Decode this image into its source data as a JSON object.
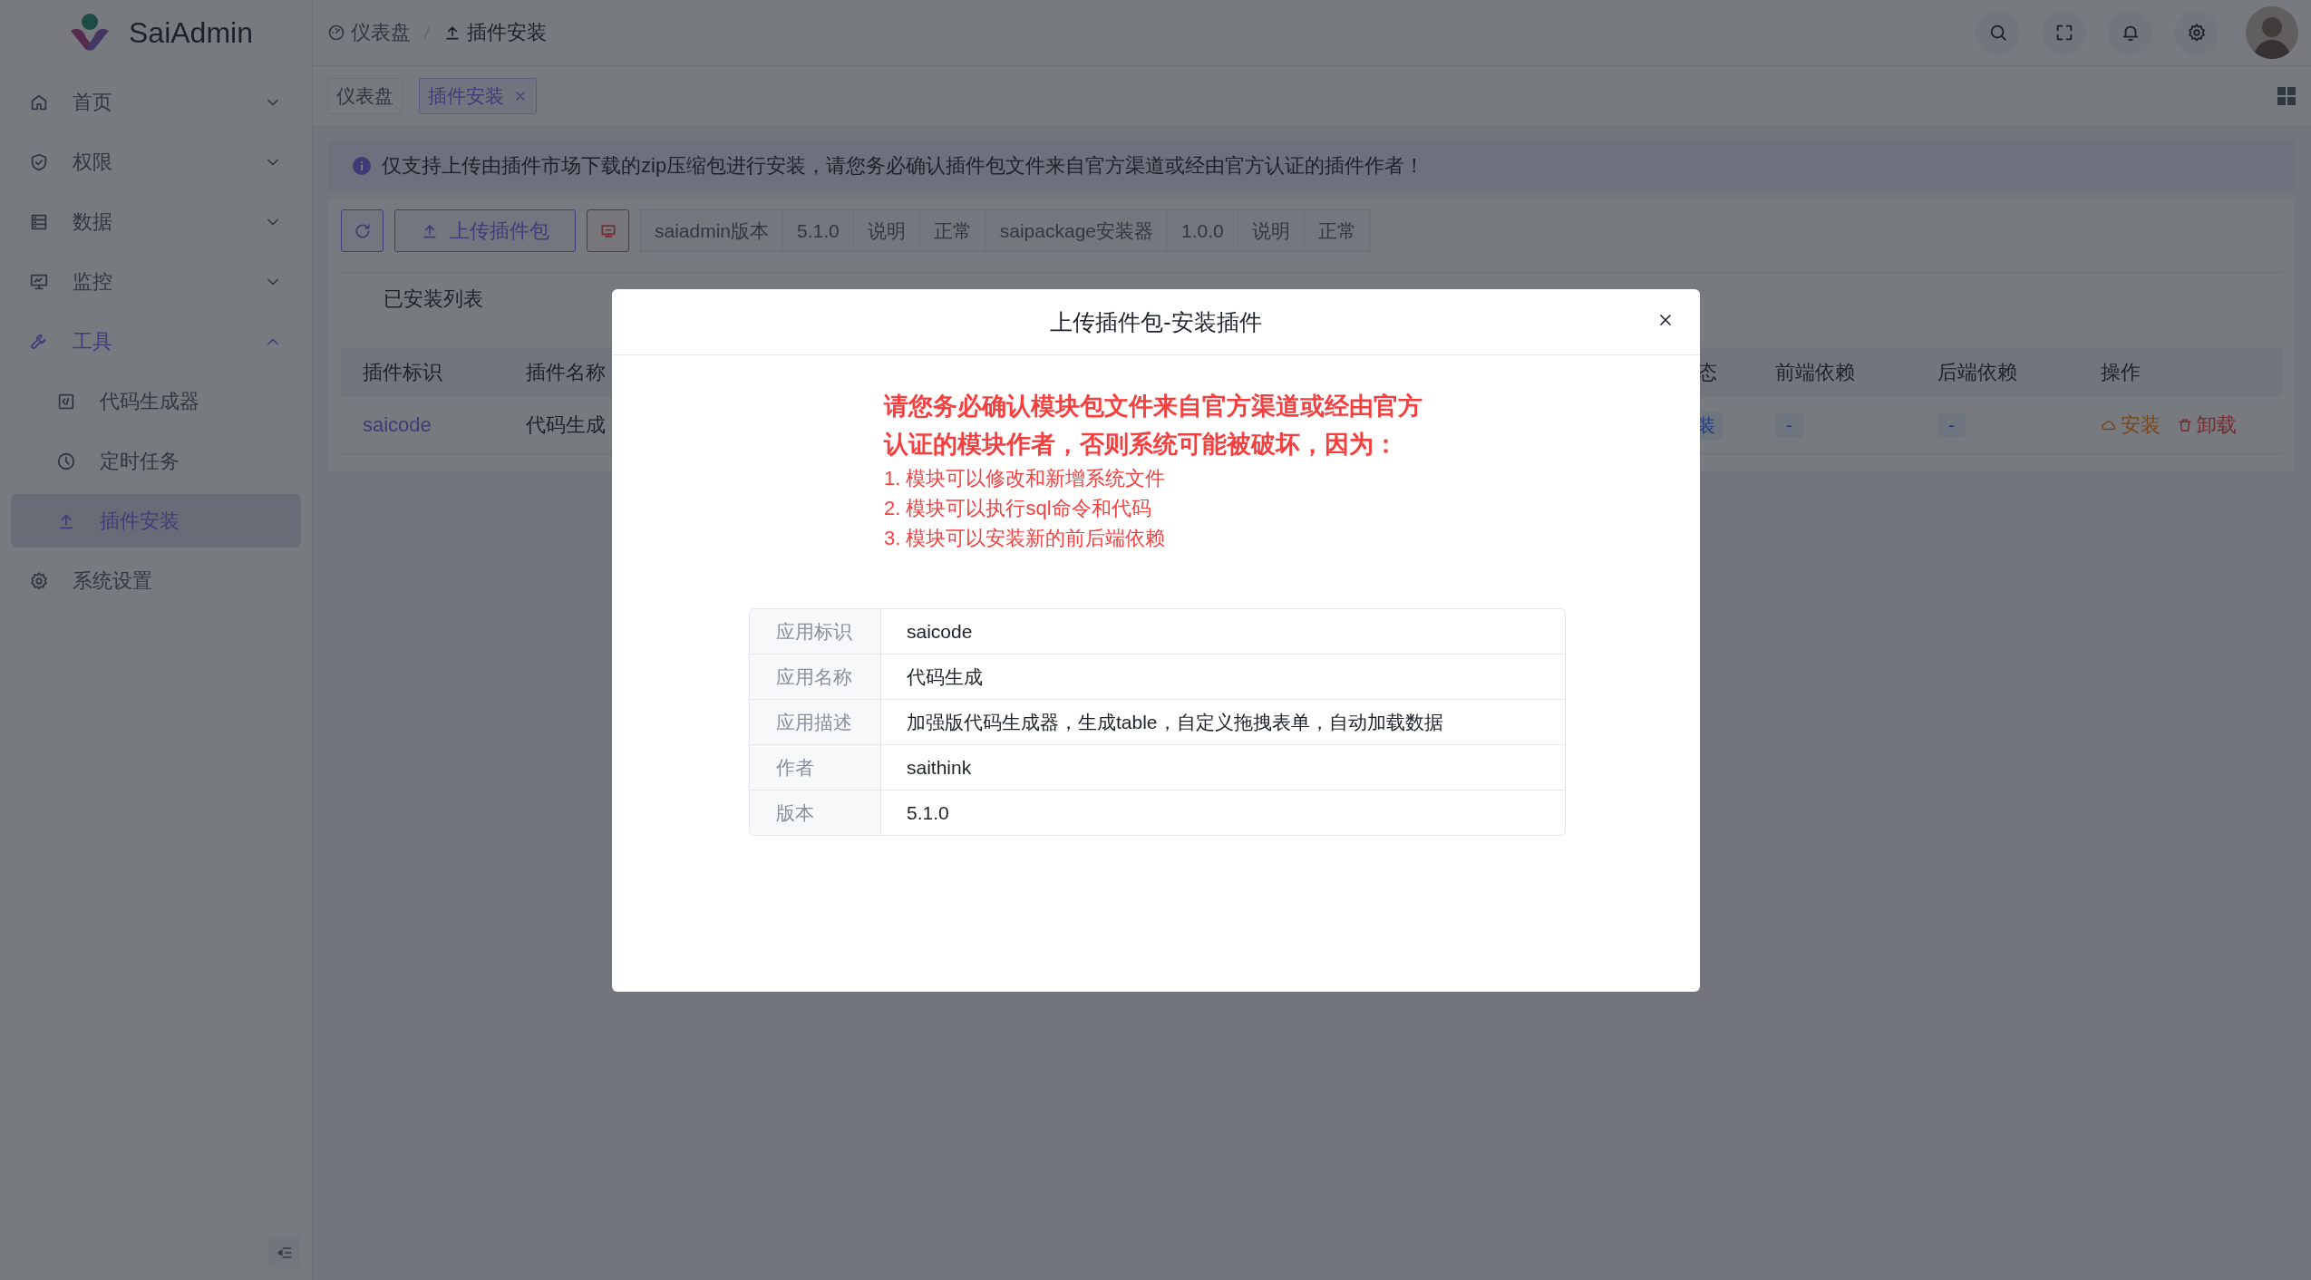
{
  "app": {
    "name": "SaiAdmin"
  },
  "breadcrumb": [
    {
      "label": "仪表盘",
      "kind": "dashboard"
    },
    {
      "label": "插件安装",
      "kind": "upload"
    }
  ],
  "sidebar": {
    "items": [
      {
        "label": "首页",
        "expanded": false,
        "selected": false
      },
      {
        "label": "权限",
        "expanded": false,
        "selected": false
      },
      {
        "label": "数据",
        "expanded": false,
        "selected": false
      },
      {
        "label": "监控",
        "expanded": false,
        "selected": false
      },
      {
        "label": "工具",
        "expanded": true,
        "selected": false,
        "children": [
          {
            "label": "代码生成器",
            "selected": false
          },
          {
            "label": "定时任务",
            "selected": false
          },
          {
            "label": "插件安装",
            "selected": true
          }
        ]
      },
      {
        "label": "系统设置",
        "selected": false
      }
    ]
  },
  "tabs": [
    {
      "label": "仪表盘",
      "selected": false,
      "closable": false
    },
    {
      "label": "插件安装",
      "selected": true,
      "closable": true
    }
  ],
  "alert": {
    "text": "仅支持上传由插件市场下载的zip压缩包进行安装，请您务必确认插件包文件来自官方渠道或经由官方认证的插件作者！"
  },
  "toolbar": {
    "buttons": [
      {
        "kind": "refresh"
      },
      {
        "kind": "upload",
        "label": "上传插件包"
      },
      {
        "kind": "terminal"
      }
    ],
    "packages": [
      {
        "name": "saiadmin版本",
        "version": "5.1.0",
        "doc": "说明",
        "status": "正常"
      },
      {
        "name": "saipackage安装器",
        "version": "1.0.0",
        "doc": "说明",
        "status": "正常"
      }
    ]
  },
  "installed": {
    "title": "已安装列表",
    "columns": [
      "插件标识",
      "插件名称",
      "态",
      "前端依赖",
      "后端依赖",
      "操作"
    ],
    "rows": [
      {
        "cells": [
          {
            "kind": "link",
            "text": "saicode"
          },
          {
            "kind": "text",
            "text": "代码生成"
          },
          {
            "kind": "tag",
            "text": "装"
          },
          {
            "kind": "tag",
            "text": "-"
          },
          {
            "kind": "tag",
            "text": "-"
          },
          {
            "kind": "actions",
            "actions": [
              {
                "kind": "install",
                "label": "安装"
              },
              {
                "kind": "uninstall",
                "label": "卸载"
              }
            ]
          }
        ]
      }
    ]
  },
  "modal": {
    "title": "上传插件包-安装插件",
    "warning": "请您务必确认模块包文件来自官方渠道或经由官方认证的模块作者，否则系统可能被破坏，因为：",
    "reasons": [
      "1. 模块可以修改和新增系统文件",
      "2. 模块可以执行sql命令和代码",
      "3. 模块可以安装新的前后端依赖"
    ],
    "details": [
      {
        "label": "应用标识",
        "value": "saicode"
      },
      {
        "label": "应用名称",
        "value": "代码生成"
      },
      {
        "label": "应用描述",
        "value": "加强版代码生成器，生成table，自定义拖拽表单，自动加载数据"
      },
      {
        "label": "作者",
        "value": "saithink"
      },
      {
        "label": "版本",
        "value": "5.1.0"
      }
    ]
  }
}
